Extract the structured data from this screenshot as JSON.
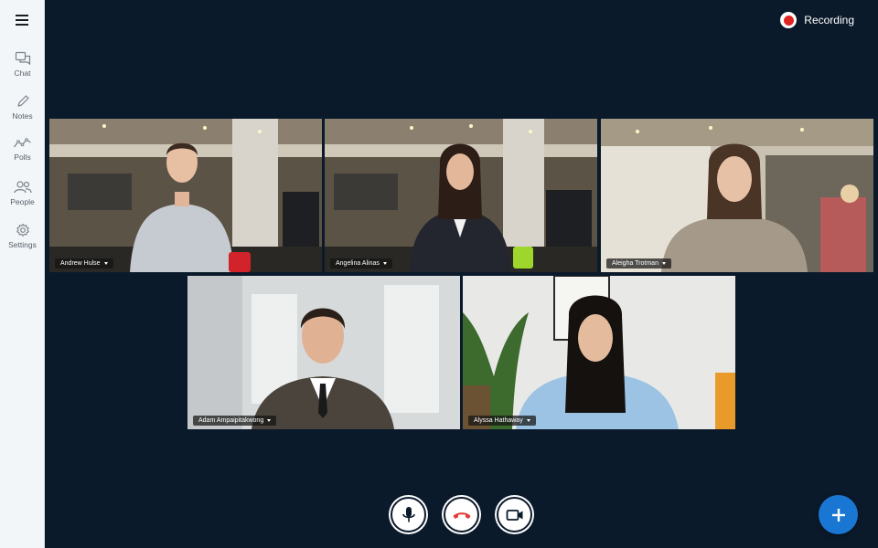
{
  "sidebar": {
    "menu_icon": "hamburger-icon",
    "items": [
      {
        "label": "Chat",
        "icon": "chat-icon"
      },
      {
        "label": "Notes",
        "icon": "pencil-icon"
      },
      {
        "label": "Polls",
        "icon": "trend-line-icon"
      },
      {
        "label": "People",
        "icon": "people-icon"
      },
      {
        "label": "Settings",
        "icon": "gear-icon"
      }
    ]
  },
  "recording": {
    "label": "Recording",
    "color": "#e02424"
  },
  "participants": [
    {
      "name": "Andrew Hulse",
      "active": false
    },
    {
      "name": "Angelina Alinas",
      "active": true
    },
    {
      "name": "Aleigha Trotman",
      "active": false
    },
    {
      "name": "Adam Ampaipitakwong",
      "active": false
    },
    {
      "name": "Alyssa Hathaway",
      "active": false
    }
  ],
  "controls": {
    "mic_icon": "microphone-icon",
    "hangup_icon": "phone-hangup-icon",
    "camera_icon": "video-camera-icon",
    "add_icon": "plus-icon",
    "hangup_color": "#e53935",
    "fab_color": "#1976d2"
  },
  "colors": {
    "background": "#0b1a2b",
    "active_border": "#4cd964",
    "sidebar": "#f2f6f9"
  }
}
